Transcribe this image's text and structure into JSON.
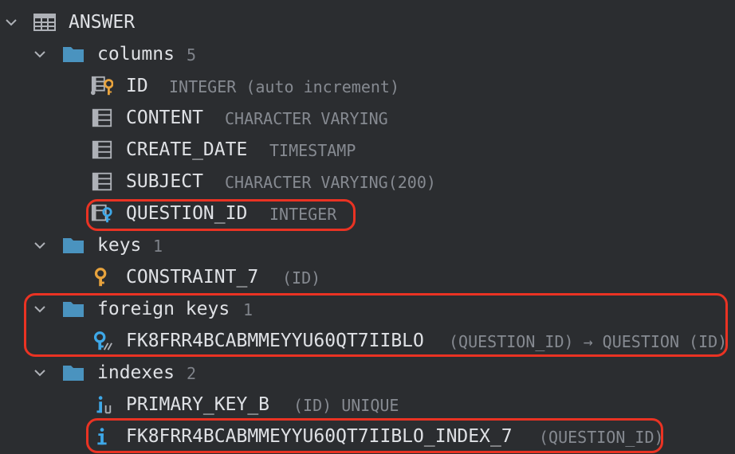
{
  "table": {
    "name": "ANSWER",
    "icon": "table-icon"
  },
  "columns_folder": {
    "label": "columns",
    "count": "5"
  },
  "columns": [
    {
      "name": "ID",
      "type": "INTEGER (auto increment)",
      "icon": "primary-key-column-icon"
    },
    {
      "name": "CONTENT",
      "type": "CHARACTER VARYING",
      "icon": "column-icon"
    },
    {
      "name": "CREATE_DATE",
      "type": "TIMESTAMP",
      "icon": "column-icon"
    },
    {
      "name": "SUBJECT",
      "type": "CHARACTER VARYING(200)",
      "icon": "column-icon"
    },
    {
      "name": "QUESTION_ID",
      "type": "INTEGER",
      "icon": "foreign-key-column-icon"
    }
  ],
  "keys_folder": {
    "label": "keys",
    "count": "1"
  },
  "keys": [
    {
      "name": "CONSTRAINT_7",
      "detail": "(ID)",
      "icon": "key-icon"
    }
  ],
  "foreign_keys_folder": {
    "label": "foreign keys",
    "count": "1"
  },
  "foreign_keys": [
    {
      "name": "FK8FRR4BCABMMEYYU60QT7IIBLO",
      "detail": "(QUESTION_ID) → QUESTION (ID)",
      "icon": "foreign-key-icon"
    }
  ],
  "indexes_folder": {
    "label": "indexes",
    "count": "2"
  },
  "indexes": [
    {
      "name": "PRIMARY_KEY_B",
      "detail": "(ID) UNIQUE",
      "icon": "unique-index-icon"
    },
    {
      "name": "FK8FRR4BCABMMEYYU60QT7IIBLO_INDEX_7",
      "detail": "(QUESTION_ID)",
      "icon": "index-icon"
    }
  ],
  "colors": {
    "background": "#2b2d30",
    "text": "#dfe1e5",
    "muted": "#868a91",
    "folder": "#4a93bf",
    "key": "#e8a33d",
    "index": "#3ea8e8",
    "highlight": "#ea3323"
  }
}
